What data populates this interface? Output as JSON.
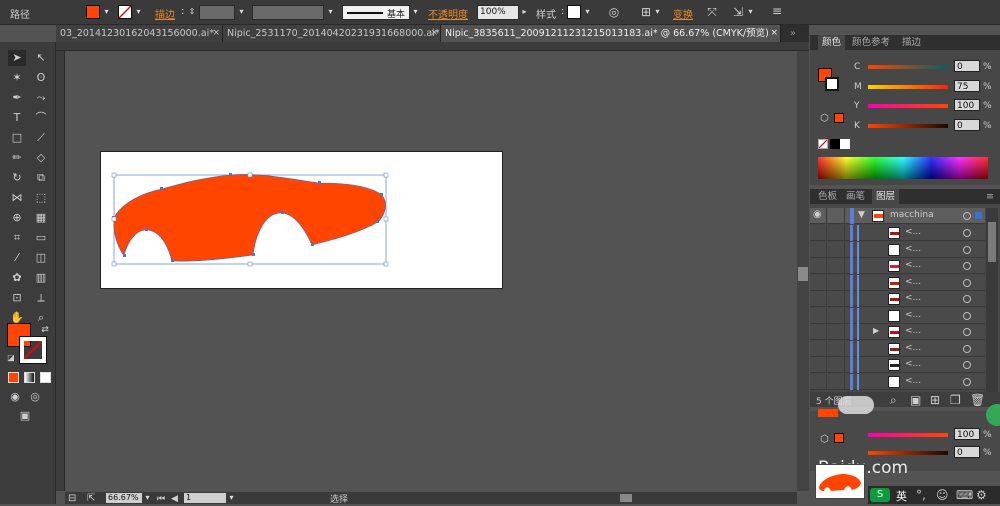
{
  "control_bar": {
    "selection_type": "路径",
    "stroke_label": "描边",
    "brush_style": "基本",
    "opacity_label": "不透明度",
    "opacity_value": "100%",
    "style_label": "样式",
    "transform_label": "变换",
    "fill_color": "#ff4500"
  },
  "tabs": [
    {
      "label": "03_20141230162043156000.ai*",
      "active": false
    },
    {
      "label": "Nipic_2531170_20140420231931668000.ai*",
      "active": false
    },
    {
      "label": "Nipic_3835611_20091211231215013183.ai* @ 66.67% (CMYK/预览)",
      "active": true
    }
  ],
  "color_panel": {
    "tabs": [
      "颜色",
      "颜色参考",
      "描边"
    ],
    "channels": [
      {
        "name": "C",
        "value": "0"
      },
      {
        "name": "M",
        "value": "75"
      },
      {
        "name": "Y",
        "value": "100"
      },
      {
        "name": "K",
        "value": "0"
      }
    ],
    "percent": "%"
  },
  "layers_panel": {
    "tabs": [
      "色板",
      "画笔",
      "图层"
    ],
    "top_layer": "macchina",
    "sublayers": [
      "<...",
      "<...",
      "<...",
      "<...",
      "<...",
      "<...",
      "<...",
      "<...",
      "<...",
      "<..."
    ],
    "count_label": "5 个图层"
  },
  "lower_color": {
    "y_value": "100",
    "k_value": "0"
  },
  "status": {
    "zoom": "66.67%",
    "artboard": "1",
    "tool_name": "选择"
  },
  "watermark": "Baidu.com",
  "ime": "英"
}
